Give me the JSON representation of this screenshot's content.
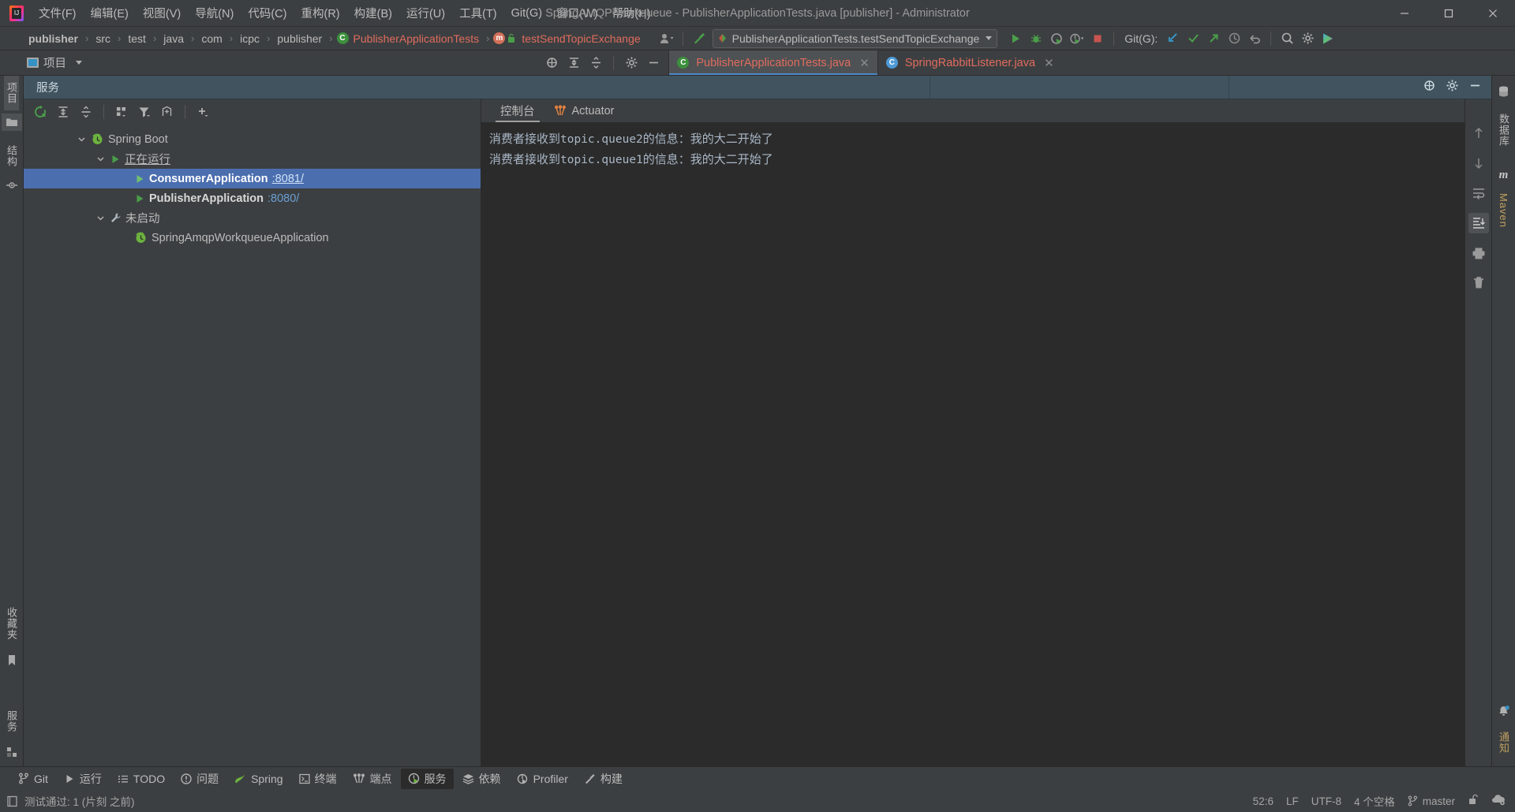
{
  "window": {
    "title": "SpringAMQP-workqueue - PublisherApplicationTests.java [publisher] - Administrator",
    "app_icon": "intellij-idea-logo",
    "minimize_label": "minimize",
    "maximize_label": "maximize",
    "close_label": "close"
  },
  "menu": {
    "items": [
      {
        "label": "文件(F)",
        "name": "menu-file"
      },
      {
        "label": "编辑(E)",
        "name": "menu-edit"
      },
      {
        "label": "视图(V)",
        "name": "menu-view"
      },
      {
        "label": "导航(N)",
        "name": "menu-navigate"
      },
      {
        "label": "代码(C)",
        "name": "menu-code"
      },
      {
        "label": "重构(R)",
        "name": "menu-refactor"
      },
      {
        "label": "构建(B)",
        "name": "menu-build"
      },
      {
        "label": "运行(U)",
        "name": "menu-run"
      },
      {
        "label": "工具(T)",
        "name": "menu-tools"
      },
      {
        "label": "Git(G)",
        "name": "menu-git"
      },
      {
        "label": "窗口(W)",
        "name": "menu-window"
      },
      {
        "label": "帮助(H)",
        "name": "menu-help"
      }
    ]
  },
  "navbar": {
    "breadcrumbs": [
      {
        "label": "publisher",
        "style": "bold"
      },
      {
        "label": "src",
        "style": "plain"
      },
      {
        "label": "test",
        "style": "plain"
      },
      {
        "label": "java",
        "style": "plain"
      },
      {
        "label": "com",
        "style": "plain"
      },
      {
        "label": "icpc",
        "style": "plain"
      },
      {
        "label": "publisher",
        "style": "plain"
      },
      {
        "label": "PublisherApplicationTests",
        "style": "class"
      },
      {
        "label": "testSendTopicExchange",
        "style": "method"
      }
    ],
    "separator": "›",
    "run_configuration": "PublisherApplicationTests.testSendTopicExchange",
    "git_label": "Git(G):",
    "icons": {
      "profile": "user-profile-icon",
      "hammer": "build-hammer-icon",
      "run": "run-icon",
      "debug": "debug-icon",
      "coverage": "run-with-coverage-icon",
      "profiler": "profiler-icon",
      "stop": "stop-icon",
      "update_project": "git-update-project-icon",
      "commit": "git-commit-icon",
      "push": "git-push-icon",
      "history": "git-history-icon",
      "rollback": "git-rollback-icon",
      "search": "search-everywhere-icon",
      "settings": "settings-gear-icon",
      "run_anything": "run-anything-icon"
    }
  },
  "tabrow": {
    "project_chip": "项目",
    "toolbar_icons": {
      "locate": "scroll-from-source-icon",
      "expand_all": "expand-all-icon",
      "collapse_all": "collapse-all-icon",
      "settings": "settings-gear-icon",
      "hide": "hide-icon",
      "more": "more-options-icon"
    },
    "tabs": [
      {
        "label": "PublisherApplicationTests.java",
        "icon": "java-class-icon",
        "active": true
      },
      {
        "label": "SpringRabbitListener.java",
        "icon": "java-class-icon",
        "active": false
      }
    ],
    "close_label": "✕"
  },
  "left_strip": {
    "tabs": [
      {
        "label": "项目",
        "name": "left-tab-project",
        "selected": true
      },
      {
        "label": "结构",
        "name": "left-tab-structure",
        "selected": false
      }
    ],
    "bottom_tabs": [
      {
        "label": "收藏夹",
        "name": "left-tab-favorites"
      },
      {
        "label": "服务",
        "name": "left-tab-services-bottom"
      }
    ],
    "icons": [
      "folder-icon",
      "bean-icon",
      "bookmark-icon",
      "grid-icon"
    ]
  },
  "toolwindow": {
    "title": "服务",
    "header_icons": {
      "locate": "locate-icon",
      "settings": "settings-gear-icon",
      "hide": "hide-window-icon"
    },
    "toolbar_icons": {
      "rerun": "rerun-icon",
      "expand_all": "expand-all-icon",
      "collapse_all": "collapse-all-icon",
      "group": "group-by-icon",
      "filter": "filter-icon",
      "show_config": "show-configurations-icon",
      "add": "add-service-icon"
    }
  },
  "services_tree": [
    {
      "label": "Spring Boot",
      "icon": "spring-boot-icon",
      "indent": 0,
      "expanded": true,
      "selected": false,
      "bold": false,
      "underline": false,
      "port": ""
    },
    {
      "label": "正在运行",
      "icon": "run-green-icon",
      "indent": 1,
      "expanded": true,
      "selected": false,
      "bold": false,
      "underline": true,
      "port": ""
    },
    {
      "label": "ConsumerApplication",
      "icon": "run-green-icon",
      "indent": 2,
      "expanded": null,
      "selected": true,
      "bold": true,
      "underline": false,
      "port": ":8081/",
      "port_underline": true
    },
    {
      "label": "PublisherApplication",
      "icon": "run-green-icon",
      "indent": 2,
      "expanded": null,
      "selected": false,
      "bold": true,
      "underline": false,
      "port": ":8080/",
      "port_underline": false
    },
    {
      "label": "未启动",
      "icon": "wrench-icon",
      "indent": 1,
      "expanded": true,
      "selected": false,
      "bold": false,
      "underline": false,
      "port": ""
    },
    {
      "label": "SpringAmqpWorkqueueApplication",
      "icon": "spring-boot-icon",
      "indent": 2,
      "expanded": null,
      "selected": false,
      "bold": false,
      "underline": false,
      "port": ""
    }
  ],
  "console": {
    "tabs": [
      {
        "label": "控制台",
        "name": "console-tab",
        "icon": "",
        "active": true
      },
      {
        "label": "Actuator",
        "name": "actuator-tab",
        "icon": "actuator-icon",
        "active": false
      }
    ],
    "lines": [
      {
        "pre": "消费者接收到",
        "mono": "topic.queue2",
        "post": "的信息：我的大二开始了"
      },
      {
        "pre": "消费者接收到",
        "mono": "topic.queue1",
        "post": "的信息：我的大二开始了"
      }
    ],
    "side_icons": [
      {
        "name": "scroll-up-icon",
        "active": false
      },
      {
        "name": "scroll-down-icon",
        "active": false
      },
      {
        "name": "soft-wrap-icon",
        "active": false
      },
      {
        "name": "scroll-to-end-icon",
        "active": true
      },
      {
        "name": "print-icon",
        "active": false
      },
      {
        "name": "clear-all-icon",
        "active": false
      }
    ]
  },
  "right_strip": {
    "tabs": [
      {
        "label": "数据库",
        "name": "right-tab-database",
        "icon": "database-icon"
      },
      {
        "label": "Maven",
        "name": "right-tab-maven",
        "icon": "maven-icon"
      }
    ],
    "bottom": [
      {
        "label": "通知",
        "name": "right-tab-notifications",
        "icon": "bell-icon"
      }
    ]
  },
  "bottom_bar": {
    "items": [
      {
        "label": "Git",
        "icon": "git-branch-icon",
        "active": false,
        "name": "bottom-tab-git"
      },
      {
        "label": "运行",
        "icon": "run-icon",
        "active": false,
        "name": "bottom-tab-run"
      },
      {
        "label": "TODO",
        "icon": "todo-list-icon",
        "active": false,
        "name": "bottom-tab-todo"
      },
      {
        "label": "问题",
        "icon": "problems-icon",
        "active": false,
        "name": "bottom-tab-problems"
      },
      {
        "label": "Spring",
        "icon": "spring-leaf-icon",
        "active": false,
        "name": "bottom-tab-spring"
      },
      {
        "label": "终端",
        "icon": "terminal-icon",
        "active": false,
        "name": "bottom-tab-terminal"
      },
      {
        "label": "端点",
        "icon": "endpoints-icon",
        "active": false,
        "name": "bottom-tab-endpoints"
      },
      {
        "label": "服务",
        "icon": "services-icon",
        "active": true,
        "name": "bottom-tab-services"
      },
      {
        "label": "依赖",
        "icon": "dependencies-icon",
        "active": false,
        "name": "bottom-tab-dependencies"
      },
      {
        "label": "Profiler",
        "icon": "profiler-icon",
        "active": false,
        "name": "bottom-tab-profiler"
      },
      {
        "label": "构建",
        "icon": "build-hammer-icon",
        "active": false,
        "name": "bottom-tab-build"
      }
    ]
  },
  "status_bar": {
    "message": "测试通过: 1 (片刻 之前)",
    "message_icon": "event-log-icon",
    "caret_position": "52:6",
    "line_separator": "LF",
    "encoding": "UTF-8",
    "indent": "4 个空格",
    "branch": "master",
    "branch_icon": "git-branch-icon",
    "lock_icon": "unlocked-icon",
    "ide_helper_icon": "cloud-settings-icon"
  },
  "colors": {
    "accent_blue": "#4b6eaf",
    "toolwindow_header": "#41535f",
    "console_bg": "#2b2b2b",
    "chrome_bg": "#3c3f41",
    "text": "#bbbbbb",
    "tab_text_red": "#e06c5e",
    "green": "#4a9e4a",
    "port_blue": "#6a9fd4"
  }
}
